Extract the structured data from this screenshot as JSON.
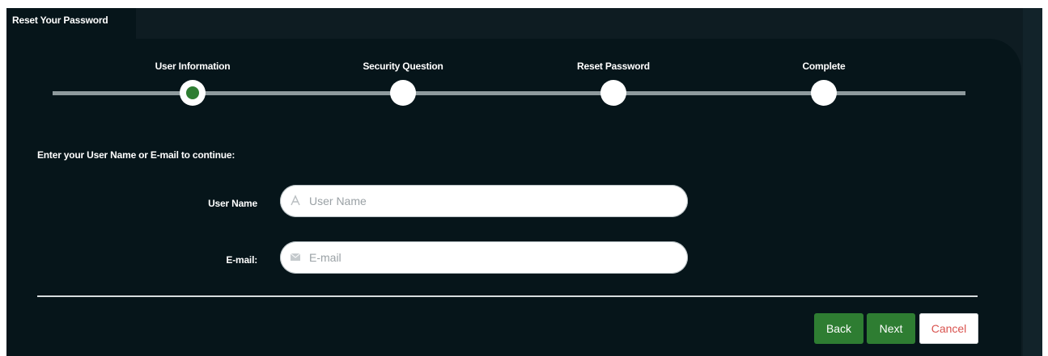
{
  "tab": {
    "label": "Reset Your Password"
  },
  "steps": [
    {
      "label": "User Information",
      "state": "active"
    },
    {
      "label": "Security Question",
      "state": "pending"
    },
    {
      "label": "Reset Password",
      "state": "pending"
    },
    {
      "label": "Complete",
      "state": "pending"
    }
  ],
  "form": {
    "instruction": "Enter your User Name or E-mail to continue:",
    "username": {
      "label": "User Name",
      "placeholder": "User Name",
      "value": "",
      "icon": "user-icon"
    },
    "email": {
      "label": "E-mail:",
      "placeholder": "E-mail",
      "value": "",
      "icon": "envelope-icon"
    }
  },
  "buttons": {
    "back": "Back",
    "next": "Next",
    "cancel": "Cancel"
  },
  "colors": {
    "background": "#06151a",
    "accent": "#2e7d32",
    "cancel_text": "#d9534f",
    "track": "#8e9a9d"
  }
}
